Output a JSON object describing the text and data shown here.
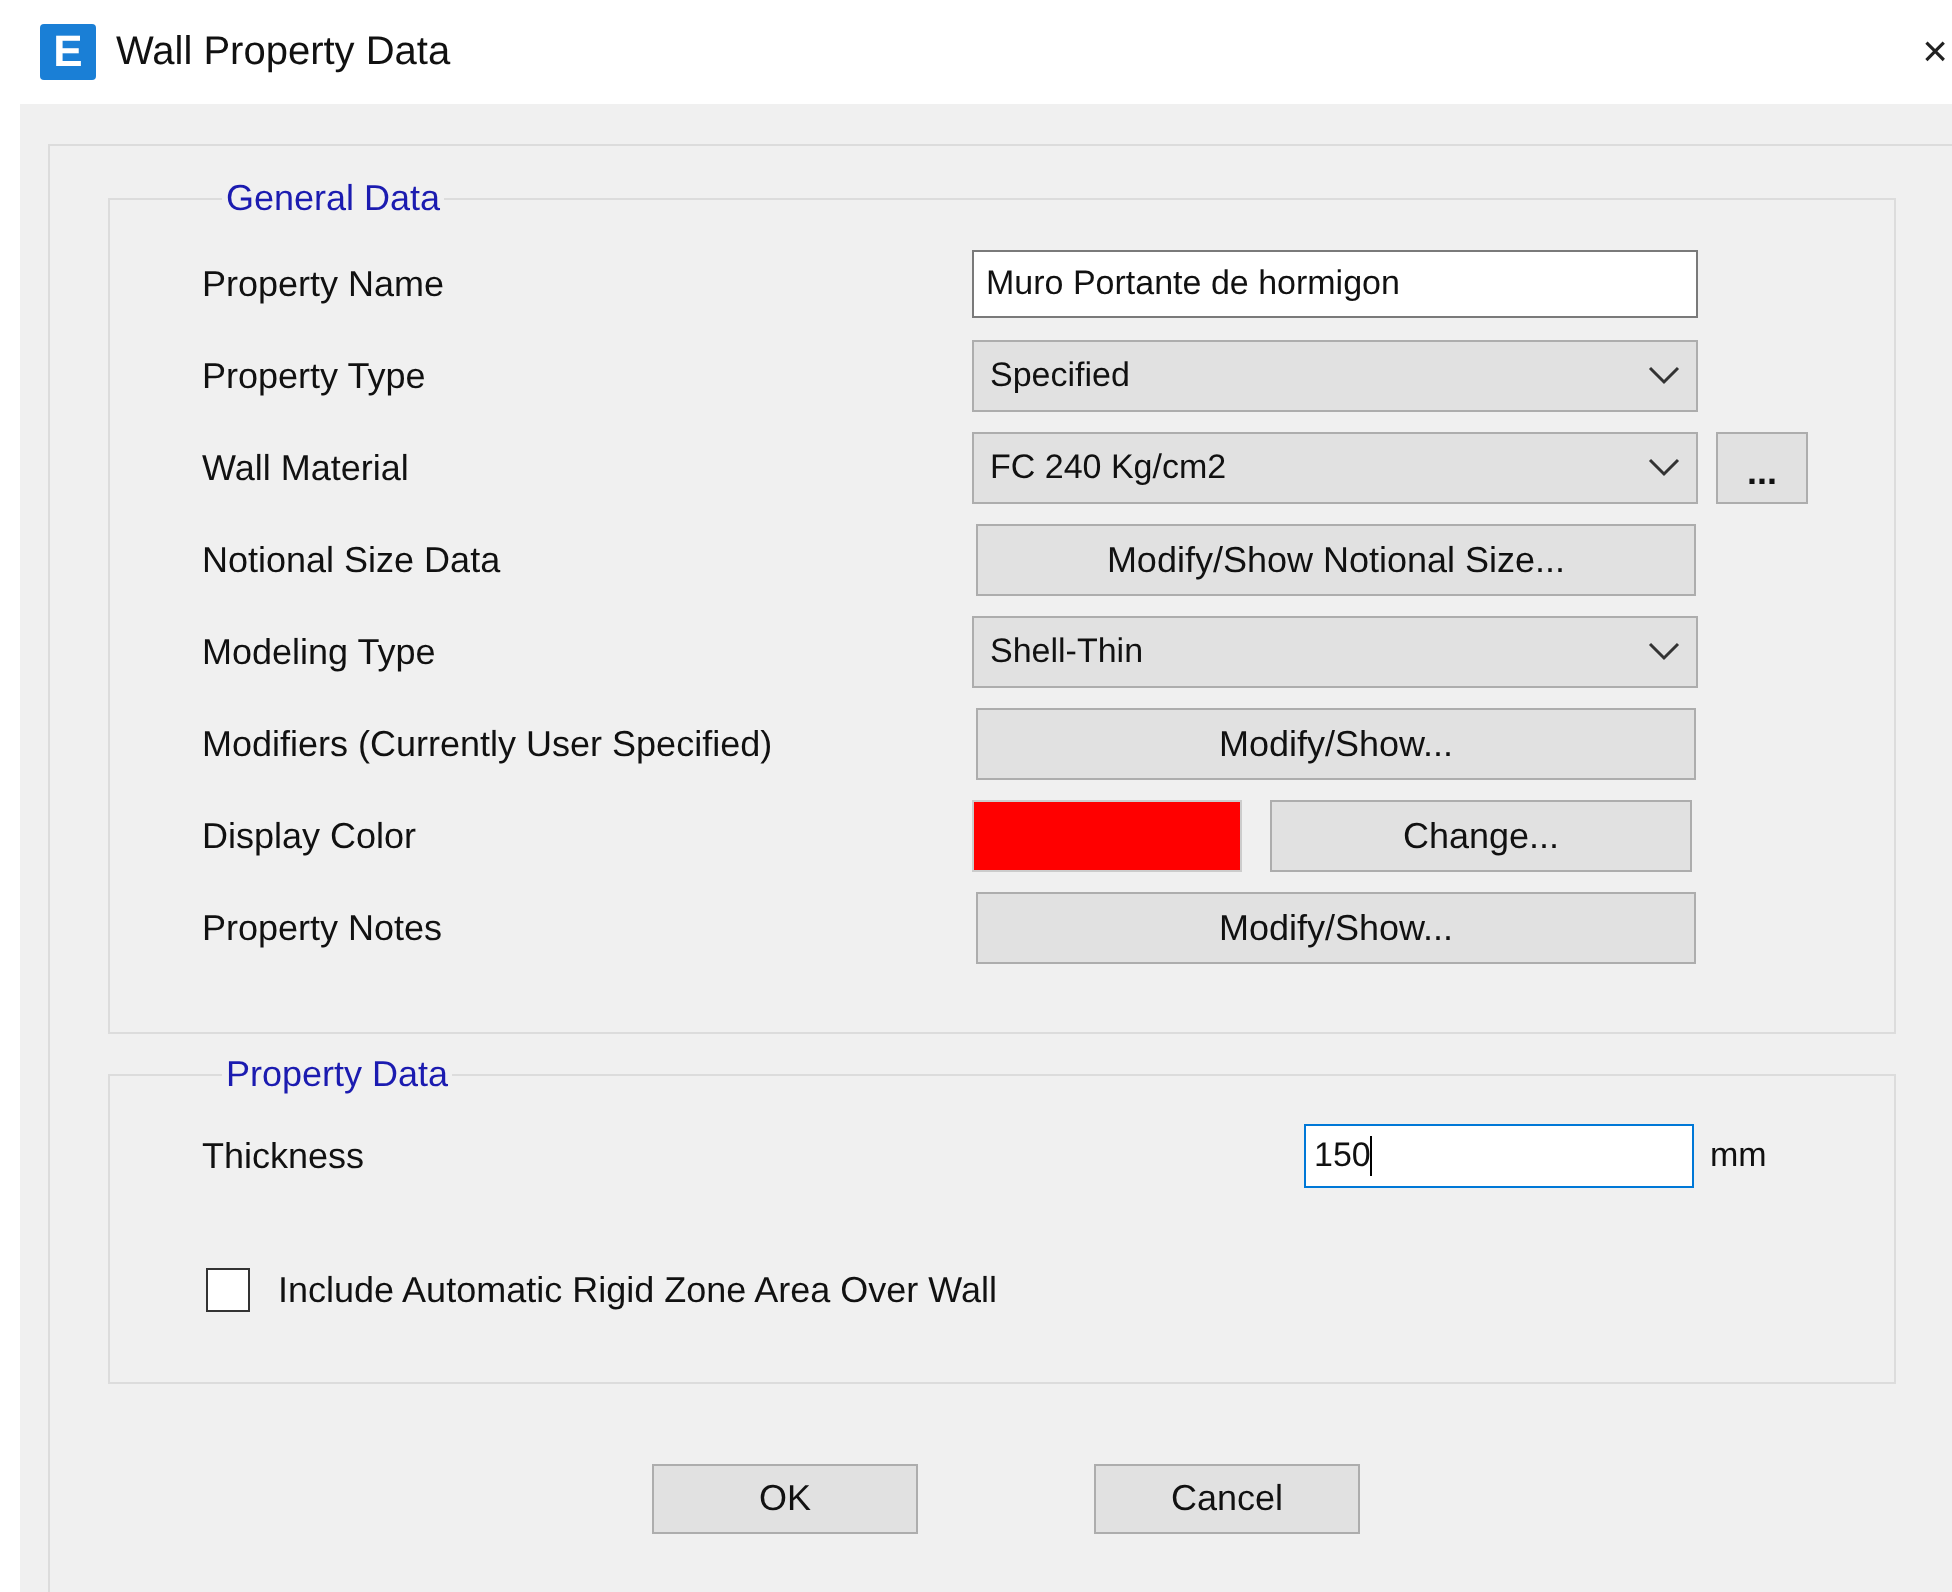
{
  "window": {
    "icon_letter": "E",
    "title": "Wall Property Data",
    "close": "×"
  },
  "general_data": {
    "title": "General Data",
    "rows": [
      {
        "kind": "text",
        "label": "Property Name",
        "value": "Muro Portante de hormigon"
      },
      {
        "kind": "dropdown",
        "label": "Property Type",
        "value": "Specified"
      },
      {
        "kind": "dropdown",
        "label": "Wall Material",
        "value": "FC 240 Kg/cm2",
        "extra_button": "..."
      },
      {
        "kind": "button",
        "label": "Notional Size Data",
        "button": "Modify/Show Notional Size..."
      },
      {
        "kind": "dropdown",
        "label": "Modeling Type",
        "value": "Shell-Thin"
      },
      {
        "kind": "button",
        "label": "Modifiers (Currently User Specified)",
        "button": "Modify/Show..."
      },
      {
        "kind": "color",
        "label": "Display Color",
        "color": "#ff0000",
        "button": "Change..."
      },
      {
        "kind": "button",
        "label": "Property Notes",
        "button": "Modify/Show..."
      }
    ]
  },
  "property_data": {
    "title": "Property Data",
    "thickness": {
      "label": "Thickness",
      "value": "150",
      "unit": "mm",
      "focused": true
    },
    "rigid_zone": {
      "label": "Include Automatic Rigid Zone Area Over Wall",
      "checked": false
    }
  },
  "buttons": [
    "OK",
    "Cancel"
  ]
}
